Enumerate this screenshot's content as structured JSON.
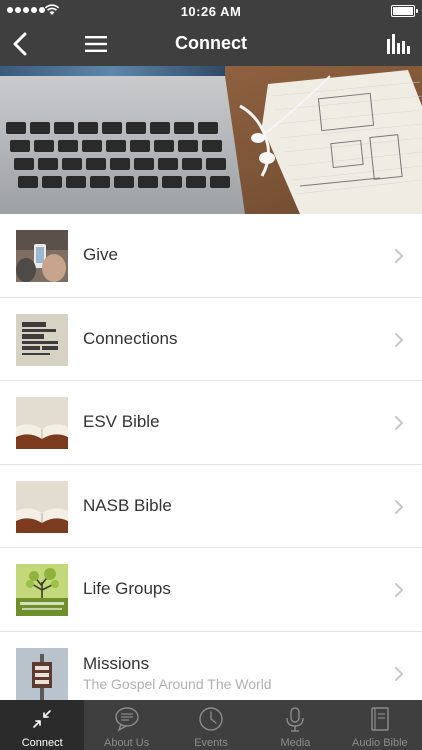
{
  "status_bar": {
    "time": "10:26 AM"
  },
  "nav": {
    "title": "Connect"
  },
  "list": [
    {
      "title": "Give",
      "subtitle": ""
    },
    {
      "title": "Connections",
      "subtitle": ""
    },
    {
      "title": "ESV Bible",
      "subtitle": ""
    },
    {
      "title": "NASB Bible",
      "subtitle": ""
    },
    {
      "title": "Life Groups",
      "subtitle": ""
    },
    {
      "title": "Missions",
      "subtitle": "The Gospel Around The World"
    }
  ],
  "tabs": [
    {
      "label": "Connect",
      "icon": "connect-icon",
      "active": true
    },
    {
      "label": "About Us",
      "icon": "chat-bubble-icon",
      "active": false
    },
    {
      "label": "Events",
      "icon": "clock-icon",
      "active": false
    },
    {
      "label": "Media",
      "icon": "microphone-icon",
      "active": false
    },
    {
      "label": "Audio Bible",
      "icon": "book-icon",
      "active": false
    }
  ],
  "colors": {
    "bar_background": "#3f3f3f",
    "active_tab": "#2b2b2b",
    "inactive_tab_text": "#8c8c8c"
  }
}
